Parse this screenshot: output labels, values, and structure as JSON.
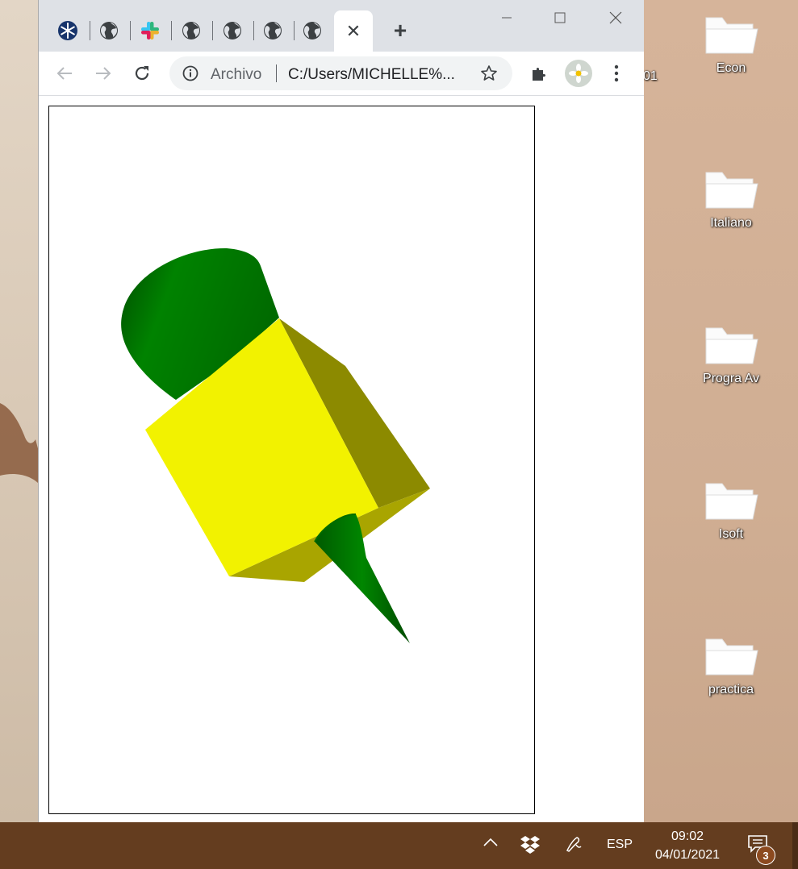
{
  "browser": {
    "tabs": [
      {
        "icon": "snowflake-icon"
      },
      {
        "icon": "globe-icon"
      },
      {
        "icon": "slack-icon"
      },
      {
        "icon": "globe-icon"
      },
      {
        "icon": "globe-icon"
      },
      {
        "icon": "globe-icon"
      },
      {
        "icon": "globe-icon"
      }
    ],
    "active_tab_close": "✕",
    "new_tab": "+",
    "address": {
      "scheme_label": "Archivo",
      "url": "C:/Users/MICHELLE%..."
    }
  },
  "page": {
    "shape_colors": {
      "cube_front": "#f2f200",
      "cube_right": "#8c8a00",
      "cube_bottom": "#a9a500",
      "cone": "#007a00"
    }
  },
  "desktop": {
    "partial_label": "01",
    "icons": [
      {
        "label": "Econ"
      },
      {
        "label": "Italiano"
      },
      {
        "label": "Progra Av"
      },
      {
        "label": "Isoft"
      },
      {
        "label": "practica"
      }
    ]
  },
  "taskbar": {
    "language": "ESP",
    "time": "09:02",
    "date": "04/01/2021",
    "notification_count": "3"
  }
}
